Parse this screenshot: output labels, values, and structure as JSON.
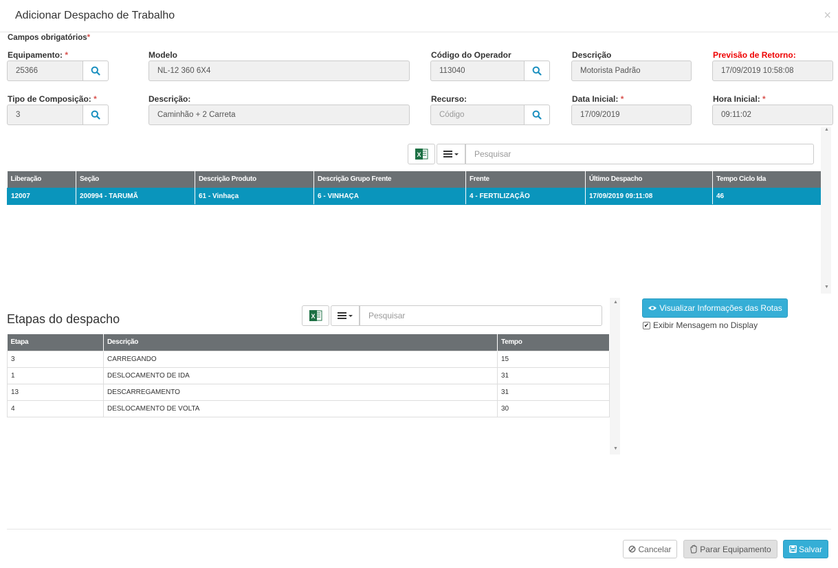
{
  "dialog": {
    "title": "Adicionar Despacho de Trabalho",
    "close_label": "×"
  },
  "required_note": "Campos obrigatórios",
  "required_star": "*",
  "form": {
    "equipamento": {
      "label": "Equipamento:",
      "value": "25366"
    },
    "modelo": {
      "label": "Modelo",
      "value": "NL-12 360 6X4"
    },
    "codigo_operador": {
      "label": "Código do Operador",
      "value": "113040"
    },
    "descricao_operador": {
      "label": "Descrição",
      "value": "Motorista Padrão"
    },
    "previsao_retorno": {
      "label": "Previsão de Retorno:",
      "value": "17/09/2019 10:58:08"
    },
    "tipo_composicao": {
      "label": "Tipo de Composição:",
      "value": "3"
    },
    "descricao_composicao": {
      "label": "Descrição:",
      "value": "Caminhão + 2 Carreta"
    },
    "recurso": {
      "label": "Recurso:",
      "placeholder": "Código"
    },
    "data_inicial": {
      "label": "Data Inicial:",
      "value": "17/09/2019"
    },
    "hora_inicial": {
      "label": "Hora Inicial:",
      "value": "09:11:02"
    }
  },
  "grid1": {
    "search_placeholder": "Pesquisar",
    "columns": [
      "Liberação",
      "Seção",
      "Descrição Produto",
      "Descrição Grupo Frente",
      "Frente",
      "Último Despacho",
      "Tempo Ciclo Ida"
    ],
    "rows": [
      [
        "12007",
        "200994 - TARUMÃ",
        "61 - Vinhaça",
        "6 - VINHAÇA",
        "4 - FERTILIZAÇÃO",
        "17/09/2019 09:11:08",
        "46"
      ]
    ]
  },
  "etapas": {
    "title": "Etapas do despacho",
    "search_placeholder": "Pesquisar",
    "columns": [
      "Etapa",
      "Descrição",
      "Tempo"
    ],
    "rows": [
      [
        "3",
        "CARREGANDO",
        "15"
      ],
      [
        "1",
        "DESLOCAMENTO DE IDA",
        "31"
      ],
      [
        "13",
        "DESCARREGAMENTO",
        "31"
      ],
      [
        "4",
        "DESLOCAMENTO DE VOLTA",
        "30"
      ]
    ]
  },
  "route_button": "Visualizar Informações das Rotas",
  "display_checkbox": {
    "label": "Exibir Mensagem no Display",
    "checked": true
  },
  "footer": {
    "cancel": "Cancelar",
    "stop": "Parar Equipamento",
    "save": "Salvar"
  },
  "colors": {
    "accent": "#35aed6",
    "selected_row": "#0a95bc",
    "header_gray": "#6b7073",
    "required": "#d9534f",
    "search_icon": "#1a8fbf",
    "excel_green": "#1d7044"
  }
}
